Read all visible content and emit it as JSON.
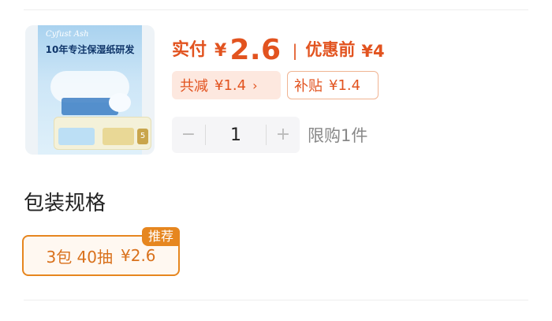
{
  "product": {
    "image": {
      "brand": "Cyfust Ash",
      "headline": "10年专注保湿纸研发",
      "subline": "",
      "banner_title": "",
      "badge_number": "5"
    }
  },
  "price": {
    "actual_label": "实付",
    "currency": "¥",
    "actual_value": "2.6",
    "separator": "|",
    "before_label": "优惠前",
    "before_value": "¥4"
  },
  "discounts": {
    "total": {
      "label": "共减",
      "amount": "¥1.4",
      "arrow": "›"
    },
    "subsidy": {
      "label": "补贴",
      "amount": "¥1.4"
    }
  },
  "quantity": {
    "minus": "−",
    "value": "1",
    "plus": "+",
    "limit_text": "限购1件"
  },
  "spec": {
    "title": "包装规格",
    "options": [
      {
        "label": "3包 40抽",
        "price": "¥2.6",
        "badge": "推荐",
        "selected": true
      }
    ]
  },
  "colors": {
    "accent": "#e2531f",
    "option_border": "#e6861f"
  }
}
